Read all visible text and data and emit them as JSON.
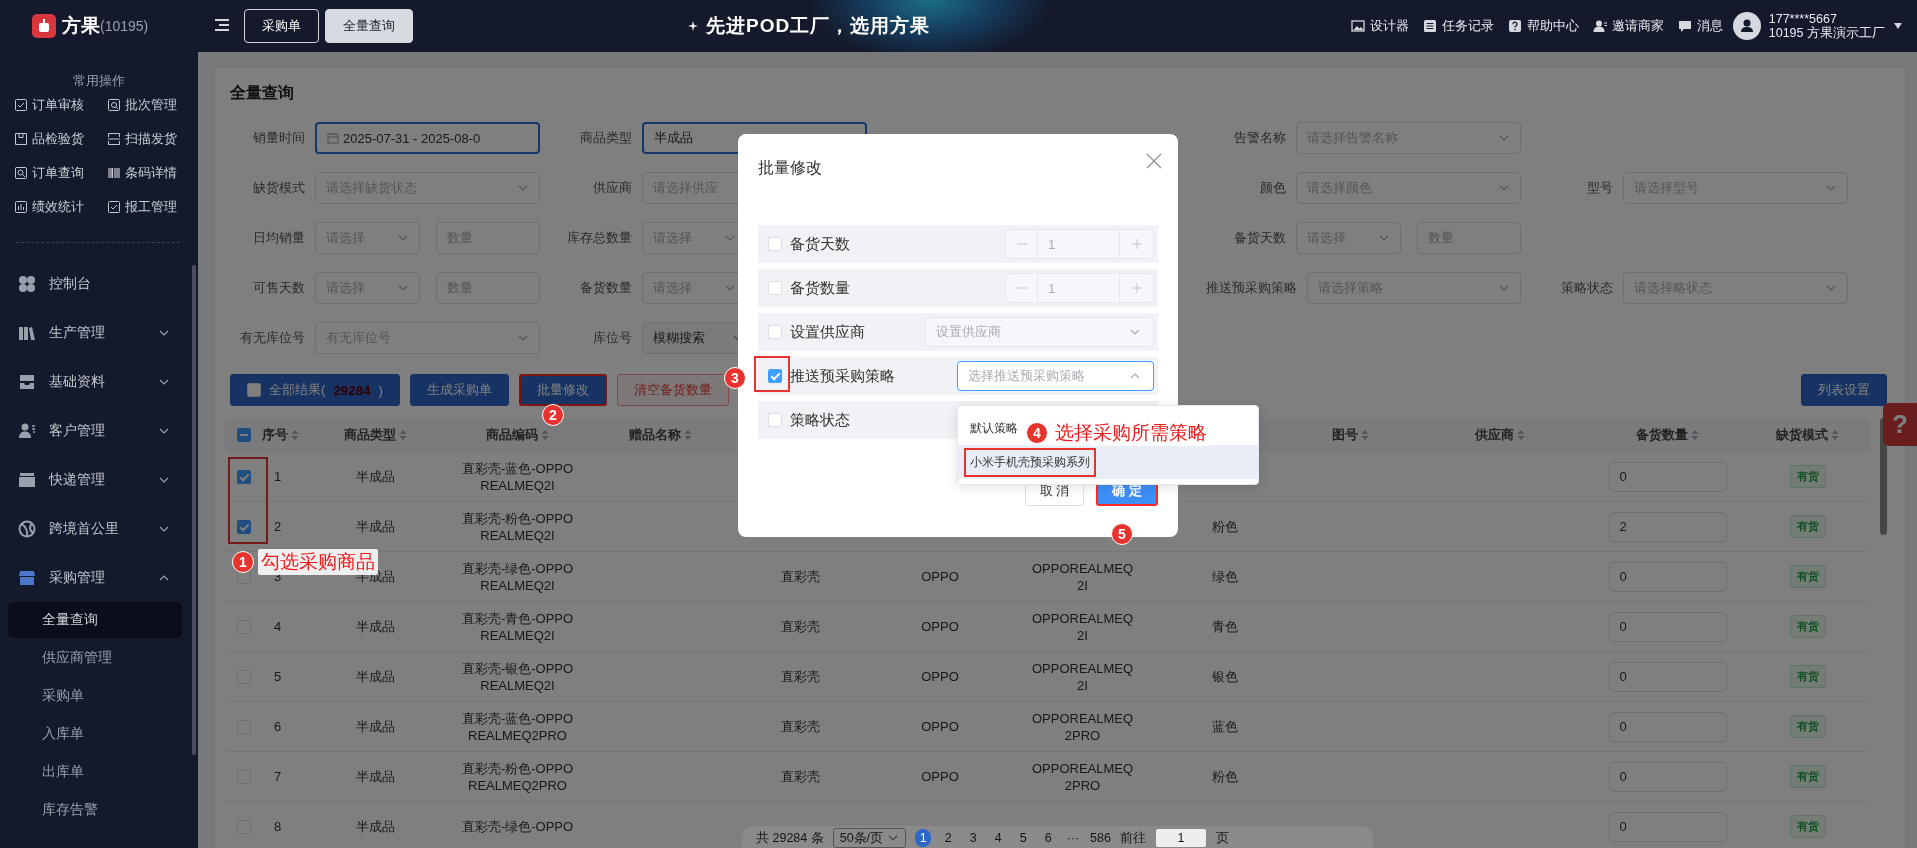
{
  "header": {
    "brand": "方果",
    "tenant": "(10195)",
    "tabs": [
      {
        "label": "采购单",
        "selected": false
      },
      {
        "label": "全量查询",
        "selected": true
      }
    ],
    "slogan": "先进POD工厂，选用方果",
    "tools": [
      {
        "label": "设计器"
      },
      {
        "label": "任务记录"
      },
      {
        "label": "帮助中心"
      },
      {
        "label": "邀请商家"
      },
      {
        "label": "消息"
      }
    ],
    "user": {
      "phone": "177****5667",
      "org": "10195 方果演示工厂"
    }
  },
  "sidebar": {
    "quick_title": "常用操作",
    "quick_actions": [
      {
        "label": "订单审核"
      },
      {
        "label": "批次管理"
      },
      {
        "label": "品检验货"
      },
      {
        "label": "扫描发货"
      },
      {
        "label": "订单查询"
      },
      {
        "label": "条码详情"
      },
      {
        "label": "绩效统计"
      },
      {
        "label": "报工管理"
      }
    ],
    "menu": [
      {
        "kind": "link",
        "label": "控制台"
      },
      {
        "kind": "group",
        "label": "生产管理",
        "expanded": false
      },
      {
        "kind": "group",
        "label": "基础资料",
        "expanded": false
      },
      {
        "kind": "group",
        "label": "客户管理",
        "expanded": false
      },
      {
        "kind": "group",
        "label": "快递管理",
        "expanded": false
      },
      {
        "kind": "group",
        "label": "跨境首公里",
        "expanded": false
      },
      {
        "kind": "group",
        "label": "采购管理",
        "expanded": true,
        "children": [
          {
            "label": "全量查询",
            "selected": true
          },
          {
            "label": "供应商管理",
            "selected": false
          },
          {
            "label": "采购单",
            "selected": false
          },
          {
            "label": "入库单",
            "selected": false
          },
          {
            "label": "出库单",
            "selected": false
          },
          {
            "label": "库存告警",
            "selected": false
          }
        ]
      }
    ]
  },
  "page": {
    "title": "全量查询",
    "filters": [
      [
        {
          "label": "销量时间",
          "kind": "date",
          "value": "2025-07-31 - 2025-08-0",
          "active": true
        },
        {
          "label": "商品类型",
          "kind": "input",
          "value": "半成品",
          "active": true
        },
        {
          "label": "告警名称",
          "kind": "select",
          "placeholder": "请选择告警名称",
          "active": false
        }
      ],
      [
        {
          "label": "缺货模式",
          "kind": "select",
          "placeholder": "请选择缺货状态",
          "active": false
        },
        {
          "label": "供应商",
          "kind": "select",
          "placeholder": "请选择供应",
          "active": false
        },
        {
          "label": "颜色",
          "kind": "select",
          "placeholder": "请选择颜色",
          "active": false
        },
        {
          "label": "型号",
          "kind": "select",
          "placeholder": "请选择型号",
          "active": false
        }
      ],
      [
        {
          "label": "日均销量",
          "kind": "pair",
          "select": "请选择",
          "input": "数量",
          "active": false
        },
        {
          "label": "库存总数量",
          "kind": "pair",
          "select": "请选择",
          "active": false
        },
        {
          "label": "备货天数",
          "kind": "pair",
          "select": "请选择",
          "input": "数量",
          "active": false
        }
      ],
      [
        {
          "label": "可售天数",
          "kind": "pair",
          "select": "请选择",
          "input": "数量",
          "active": false
        },
        {
          "label": "备货数量",
          "kind": "pair",
          "select": "请选择",
          "active": false
        },
        {
          "label": "推送预采购策略",
          "kind": "select",
          "placeholder": "请选择策略",
          "active": false
        },
        {
          "label": "策略状态",
          "kind": "select",
          "placeholder": "请选择略状态",
          "active": false
        }
      ],
      [
        {
          "label": "有无库位号",
          "kind": "select",
          "placeholder": "有无库位号",
          "active": false
        },
        {
          "label": "库位号",
          "kind": "combo",
          "value": "模糊搜索",
          "active": false
        }
      ]
    ],
    "actions": [
      {
        "kind": "select-all",
        "checked": false,
        "label": "全部结果(",
        "count": "29284",
        "suffix": ")",
        "highlighted": false
      },
      {
        "kind": "primary",
        "label": "生成采购单",
        "highlighted": false
      },
      {
        "kind": "primary",
        "label": "批量修改",
        "highlighted": true
      },
      {
        "kind": "danger",
        "label": "清空备货数量",
        "highlighted": false
      }
    ],
    "settings_button": "列表设置"
  },
  "table": {
    "select_all_indeterminate": true,
    "checkbox_highlight": true,
    "columns": [
      {
        "label": "序号",
        "kind": "text",
        "sortable": true
      },
      {
        "label": "商品类型",
        "kind": "text",
        "sortable": true
      },
      {
        "label": "商品编码",
        "kind": "text",
        "sortable": true
      },
      {
        "label": "赠品名称",
        "sortable": true
      },
      {
        "kind": "text"
      },
      {
        "kind": "text"
      },
      {
        "kind": "text"
      },
      {
        "kind": "text"
      },
      {
        "label": "图号",
        "sortable": true
      },
      {
        "label": "供应商",
        "sortable": true
      },
      {
        "label": "备货数量",
        "kind": "input",
        "sortable": true
      },
      {
        "label": "缺货模式",
        "kind": "tag",
        "sortable": true
      }
    ],
    "rows": [
      {
        "checked": true,
        "cells": [
          "1",
          "半成品",
          "直彩壳-蓝色-OPPO\nREALMEQ2I",
          null,
          null,
          null,
          null,
          null,
          null,
          null,
          "0",
          "有货"
        ]
      },
      {
        "checked": true,
        "cells": [
          "2",
          "半成品",
          "直彩壳-粉色-OPPO\nREALMEQ2I",
          null,
          null,
          null,
          null,
          "粉色",
          null,
          null,
          "2",
          "有货"
        ]
      },
      {
        "checked": false,
        "cells": [
          "3",
          "半成品",
          "直彩壳-绿色-OPPO\nREALMEQ2I",
          null,
          "直彩壳",
          "OPPO",
          "OPPOREALMEQ\n2I",
          "绿色",
          null,
          null,
          "0",
          "有货"
        ]
      },
      {
        "checked": false,
        "cells": [
          "4",
          "半成品",
          "直彩壳-青色-OPPO\nREALMEQ2I",
          null,
          "直彩壳",
          "OPPO",
          "OPPOREALMEQ\n2I",
          "青色",
          null,
          null,
          "0",
          "有货"
        ]
      },
      {
        "checked": false,
        "cells": [
          "5",
          "半成品",
          "直彩壳-银色-OPPO\nREALMEQ2I",
          null,
          "直彩壳",
          "OPPO",
          "OPPOREALMEQ\n2I",
          "银色",
          null,
          null,
          "0",
          "有货"
        ]
      },
      {
        "checked": false,
        "cells": [
          "6",
          "半成品",
          "直彩壳-蓝色-OPPO\nREALMEQ2PRO",
          null,
          "直彩壳",
          "OPPO",
          "OPPOREALMEQ\n2PRO",
          "蓝色",
          null,
          null,
          "0",
          "有货"
        ]
      },
      {
        "checked": false,
        "cells": [
          "7",
          "半成品",
          "直彩壳-粉色-OPPO\nREALMEQ2PRO",
          null,
          "直彩壳",
          "OPPO",
          "OPPOREALMEQ\n2PRO",
          "粉色",
          null,
          null,
          "0",
          "有货"
        ]
      },
      {
        "checked": false,
        "cells": [
          "8",
          "半成品",
          "直彩壳-绿色-OPPO",
          null,
          null,
          null,
          null,
          null,
          null,
          null,
          "0",
          "有货"
        ]
      }
    ]
  },
  "pagination": {
    "total": "共 29284 条",
    "page_size": "50条/页",
    "pages": [
      {
        "label": "1",
        "selected": true
      },
      {
        "label": "2",
        "selected": false
      },
      {
        "label": "3",
        "selected": false
      },
      {
        "label": "4",
        "selected": false
      },
      {
        "label": "5",
        "selected": false
      },
      {
        "label": "6",
        "selected": false
      },
      {
        "label": "···",
        "selected": false
      },
      {
        "label": "586",
        "selected": false
      }
    ],
    "goto_label": "前往",
    "goto_value": "1",
    "goto_suffix": "页"
  },
  "help_tab": "?",
  "modal": {
    "title": "批量修改",
    "rows": [
      {
        "label": "备货天数",
        "checked": false,
        "highlighted": false,
        "kind": "number",
        "value": "1"
      },
      {
        "label": "备货数量",
        "checked": false,
        "highlighted": false,
        "kind": "number",
        "value": "1"
      },
      {
        "label": "设置供应商",
        "checked": false,
        "highlighted": false,
        "kind": "select",
        "placeholder": "设置供应商",
        "open": false
      },
      {
        "label": "推送预采购策略",
        "checked": true,
        "highlighted": true,
        "kind": "select",
        "placeholder": "选择推送预采购策略",
        "open": true
      },
      {
        "label": "策略状态",
        "checked": false,
        "highlighted": false
      }
    ],
    "options": [
      {
        "label": "默认策略",
        "hovered": false,
        "highlighted": false
      },
      {
        "label": "小米手机壳预采购系列",
        "hovered": true,
        "highlighted": true
      }
    ],
    "buttons": [
      {
        "kind": "cancel",
        "label": "取 消",
        "highlighted": false
      },
      {
        "kind": "confirm",
        "label": "确 定",
        "highlighted": true
      }
    ]
  },
  "annotations": [
    {
      "number": "1",
      "text": "勾选采购商品"
    },
    {
      "number": "2"
    },
    {
      "number": "3"
    },
    {
      "number": "4",
      "text": "选择采购所需策略"
    },
    {
      "number": "5"
    }
  ]
}
